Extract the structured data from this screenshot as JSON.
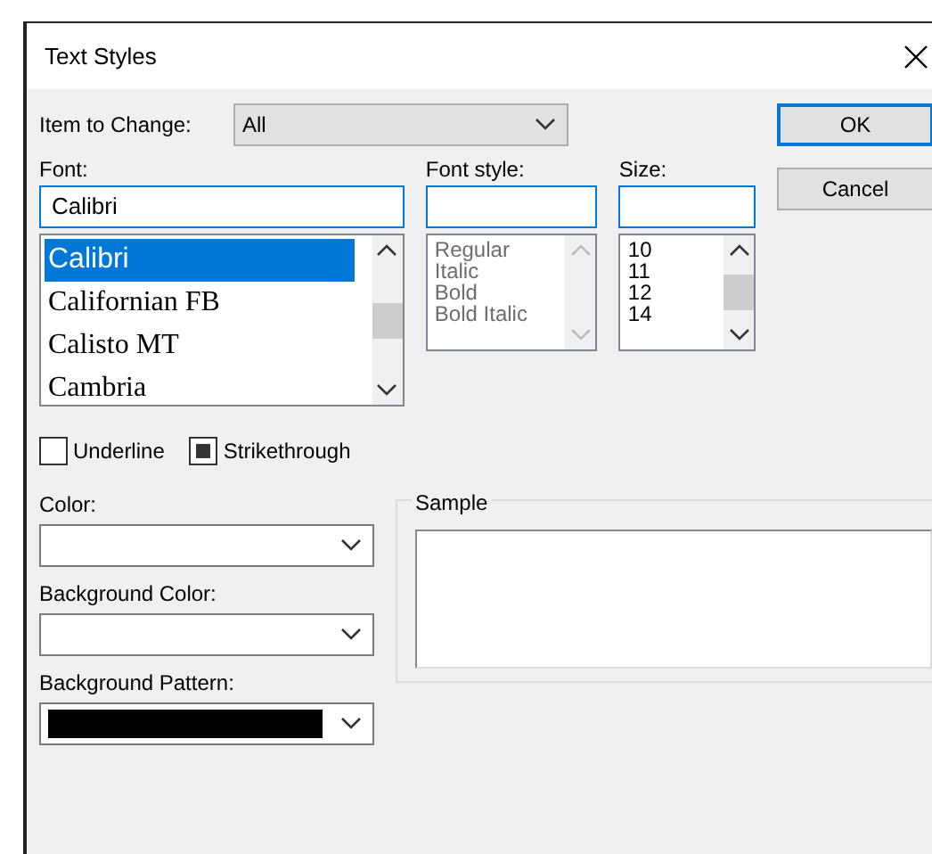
{
  "window": {
    "title": "Text Styles"
  },
  "item_to_change": {
    "label": "Item to Change:",
    "value": "All"
  },
  "buttons": [
    {
      "label": "OK",
      "default": true
    },
    {
      "label": "Cancel",
      "default": false
    }
  ],
  "font": {
    "label": "Font:",
    "value": "Calibri",
    "items": [
      {
        "text": "Calibri",
        "kind": "sans",
        "selected": true
      },
      {
        "text": "Californian FB",
        "kind": "serif",
        "selected": false
      },
      {
        "text": "Calisto MT",
        "kind": "serif",
        "selected": false
      },
      {
        "text": "Cambria",
        "kind": "serif",
        "selected": false
      }
    ]
  },
  "font_style": {
    "label": "Font style:",
    "disabled": true,
    "items": [
      "Regular",
      "Italic",
      "Bold",
      "Bold Italic"
    ]
  },
  "size": {
    "label": "Size:",
    "disabled": false,
    "items": [
      "10",
      "11",
      "12",
      "14"
    ]
  },
  "effects": [
    {
      "label": "Underline",
      "checked": false,
      "indeterminate": false
    },
    {
      "label": "Strikethrough",
      "checked": false,
      "indeterminate": true
    }
  ],
  "fields": [
    {
      "label": "Color:"
    },
    {
      "label": "Background Color:"
    },
    {
      "label": "Background Pattern:",
      "color": "#000000"
    }
  ],
  "sample": {
    "label": "Sample"
  }
}
